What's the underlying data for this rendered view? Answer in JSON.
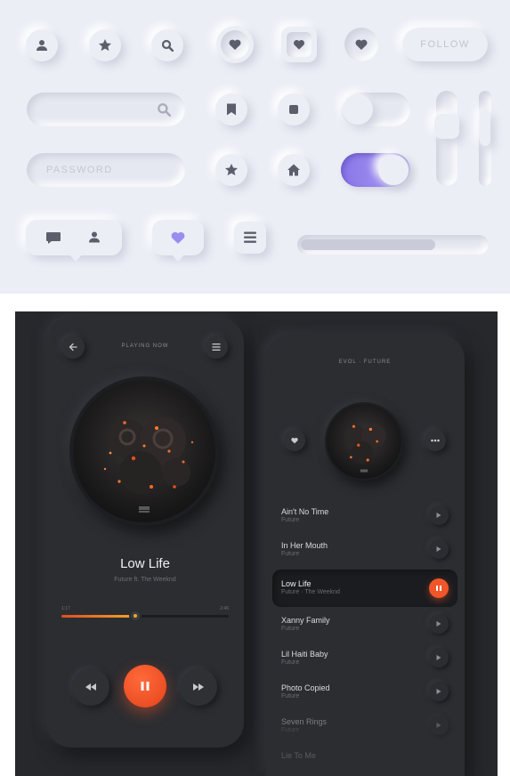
{
  "light_panel": {
    "follow_label": "FOLLOW",
    "password_placeholder": "PASSWORD",
    "slider_fill": 0.73,
    "toggle_off": false,
    "toggle_on": true,
    "accent_color": "#9b8cf0",
    "icons": [
      "user-icon",
      "star-icon",
      "search-icon",
      "heart-icon",
      "bookmark-icon",
      "stop-icon",
      "home-icon",
      "chat-icon",
      "menu-icon"
    ]
  },
  "player": {
    "header": "PLAYING NOW",
    "song_title": "Low Life",
    "song_artist": "Future ft. The Weeknd",
    "time_elapsed": "1:17",
    "time_total": "2:46",
    "progress": 0.44,
    "accent_color": "#f0562a"
  },
  "playlist": {
    "header": "EVOL · FUTURE",
    "tracks": [
      {
        "title": "Ain't No Time",
        "artist": "Future"
      },
      {
        "title": "In Her Mouth",
        "artist": "Future"
      },
      {
        "title": "Low Life",
        "artist": "Future · The Weeknd",
        "active": true
      },
      {
        "title": "Xanny Family",
        "artist": "Future"
      },
      {
        "title": "Lil Haiti Baby",
        "artist": "Future"
      },
      {
        "title": "Photo Copied",
        "artist": "Future"
      },
      {
        "title": "Seven Rings",
        "artist": "Future"
      },
      {
        "title": "Lie To Me",
        "artist": ""
      }
    ]
  }
}
